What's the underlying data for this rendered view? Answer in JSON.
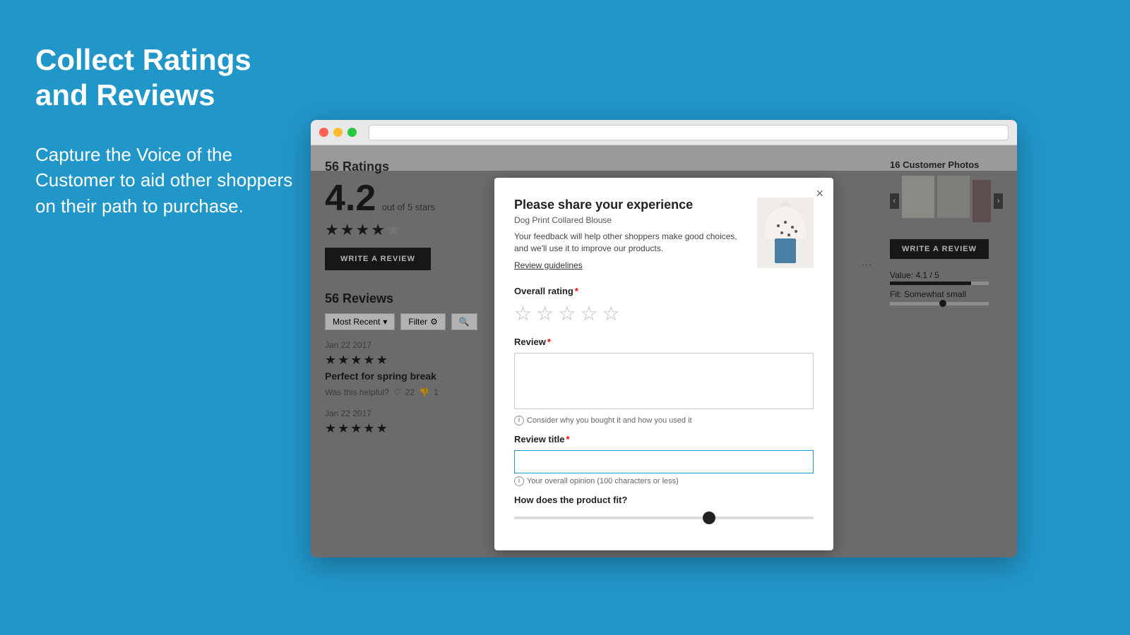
{
  "page": {
    "background_color": "#2196C9"
  },
  "left": {
    "main_title": "Collect Ratings and Reviews",
    "subtitle": "Capture the Voice of the Customer to aid other shoppers on their path to purchase."
  },
  "browser": {
    "dots": [
      "red",
      "yellow",
      "green"
    ],
    "ratings_panel": {
      "title": "56 Ratings",
      "score": "4.2",
      "out_of": "out of 5 stars",
      "write_review_btn": "WRITE A REVIEW",
      "reviews_title": "56 Reviews",
      "filter_label": "Most Recent",
      "filter_btn": "Filter",
      "search_placeholder": "Search"
    },
    "reviews": [
      {
        "date": "Jan 22 2017",
        "stars": 5,
        "headline": "Perfect for spring break",
        "helpful_text": "Was this helpful?",
        "helpful_count": "22",
        "unhelpful_count": "1"
      },
      {
        "date": "Jan 22 2017",
        "stars": 5,
        "headline": ""
      }
    ],
    "right_panel": {
      "photos_title": "16 Customer Photos",
      "write_review_btn": "WRITE A REVIEW",
      "value_label": "Value: 4.1 / 5",
      "fit_label": "Fit: Somewhat small"
    }
  },
  "modal": {
    "title": "Please share your experience",
    "product_name": "Dog Print Collared Blouse",
    "description": "Your feedback will help other shoppers make good choices, and we'll use it to improve our products.",
    "guidelines_link": "Review guidelines",
    "close_btn": "×",
    "overall_rating_label": "Overall rating",
    "review_label": "Review",
    "review_hint": "Consider why you bought it and how you used it",
    "review_title_label": "Review title",
    "review_title_hint": "Your overall opinion (100 characters or less)",
    "product_fit_label": "How does the product fit?"
  }
}
